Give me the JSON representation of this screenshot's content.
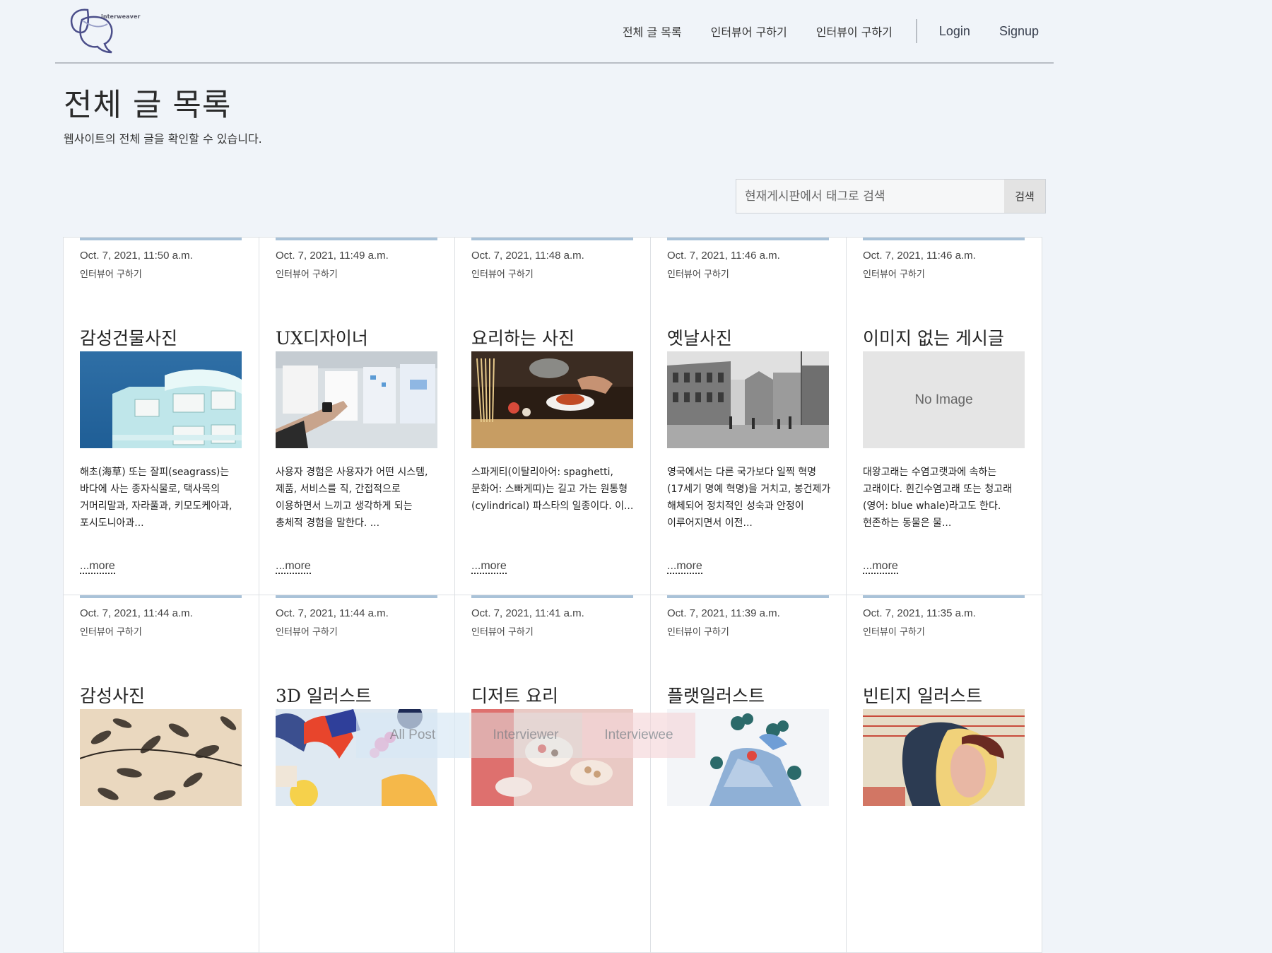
{
  "header": {
    "logo_text": "interweaver",
    "nav": [
      "전체 글 목록",
      "인터뷰어 구하기",
      "인터뷰이 구하기"
    ],
    "login": "Login",
    "signup": "Signup"
  },
  "page": {
    "title": "전체 글 목록",
    "subtitle": "웹사이트의 전체 글을 확인할 수 있습니다."
  },
  "search": {
    "placeholder": "현재게시판에서 태그로 검색",
    "button": "검색"
  },
  "posts": [
    {
      "date": "Oct. 7, 2021, 11:50 a.m.",
      "category": "인터뷰어 구하기",
      "title": "감성건물사진",
      "image": "building",
      "excerpt": "해초(海草) 또는 잘피(seagrass)는 바다에 사는 종자식물로, 택사목의 거머리말과, 자라풀과, 키모도케아과, 포시도니아과...",
      "more": "...more"
    },
    {
      "date": "Oct. 7, 2021, 11:49 a.m.",
      "category": "인터뷰어 구하기",
      "title": "UX디자이너",
      "image": "ux-board",
      "excerpt": "사용자 경험은 사용자가 어떤 시스템, 제품, 서비스를 직, 간접적으로 이용하면서 느끼고 생각하게 되는 총체적 경험을 말한다. ...",
      "more": "...more"
    },
    {
      "date": "Oct. 7, 2021, 11:48 a.m.",
      "category": "인터뷰어 구하기",
      "title": "요리하는 사진",
      "image": "cooking",
      "excerpt": "스파게티(이탈리아어: spaghetti, 문화어: 스빠게띠)는 길고 가는 원통형(cylindrical) 파스타의 일종이다. 이...",
      "more": "...more"
    },
    {
      "date": "Oct. 7, 2021, 11:46 a.m.",
      "category": "인터뷰어 구하기",
      "title": "옛날사진",
      "image": "old-street",
      "excerpt": "영국에서는 다른 국가보다 일찍 혁명(17세기 명예 혁명)을 거치고, 봉건제가 해체되어 정치적인 성숙과 안정이 이루어지면서 이전...",
      "more": "...more"
    },
    {
      "date": "Oct. 7, 2021, 11:46 a.m.",
      "category": "인터뷰어 구하기",
      "title": "이미지 없는 게시글",
      "image": "none",
      "no_image_label": "No Image",
      "excerpt": "대왕고래는 수염고랫과에 속하는 고래이다. 흰긴수염고래 또는 청고래(영어: blue whale)라고도 한다. 현존하는 동물은 물...",
      "more": "...more"
    },
    {
      "date": "Oct. 7, 2021, 11:44 a.m.",
      "category": "인터뷰어 구하기",
      "title": "감성사진",
      "image": "leaves",
      "excerpt": "",
      "more": ""
    },
    {
      "date": "Oct. 7, 2021, 11:44 a.m.",
      "category": "인터뷰어 구하기",
      "title": "3D 일러스트",
      "image": "3d",
      "excerpt": "",
      "more": ""
    },
    {
      "date": "Oct. 7, 2021, 11:41 a.m.",
      "category": "인터뷰어 구하기",
      "title": "디저트 요리",
      "image": "dessert",
      "excerpt": "",
      "more": ""
    },
    {
      "date": "Oct. 7, 2021, 11:39 a.m.",
      "category": "인터뷰이 구하기",
      "title": "플랫일러스트",
      "image": "flat",
      "excerpt": "",
      "more": ""
    },
    {
      "date": "Oct. 7, 2021, 11:35 a.m.",
      "category": "인터뷰이 구하기",
      "title": "빈티지 일러스트",
      "image": "vintage",
      "excerpt": "",
      "more": ""
    }
  ],
  "filter": [
    "All Post",
    "Interviewer",
    "Interviewee"
  ],
  "colors": {
    "background": "#f0f4f9",
    "card_accent": "#a9c2d8",
    "divider": "#b9bec5"
  }
}
